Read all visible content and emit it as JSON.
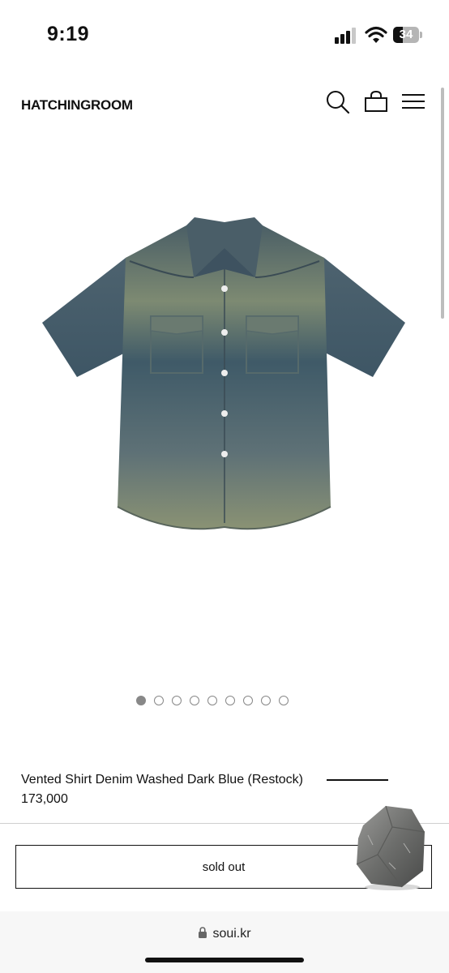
{
  "status_bar": {
    "time": "9:19",
    "battery": "34",
    "signal_bars_active": 3,
    "signal_bars_total": 4
  },
  "header": {
    "logo": "HATCHINGROOM",
    "icons": [
      "search-icon",
      "shopping-bag-icon",
      "menu-icon"
    ]
  },
  "gallery": {
    "image_alt": "denim short-sleeve shirt",
    "total_images": 9,
    "active_index": 0
  },
  "product": {
    "name": "Vented Shirt Denim Washed Dark Blue (Restock)",
    "price": "173,000",
    "button_label": "sold out"
  },
  "browser": {
    "url": "soui.kr"
  },
  "colors": {
    "denim_dark": "#3e5560",
    "denim_light": "#7f8b70",
    "text": "#111111",
    "dot": "#888888"
  }
}
